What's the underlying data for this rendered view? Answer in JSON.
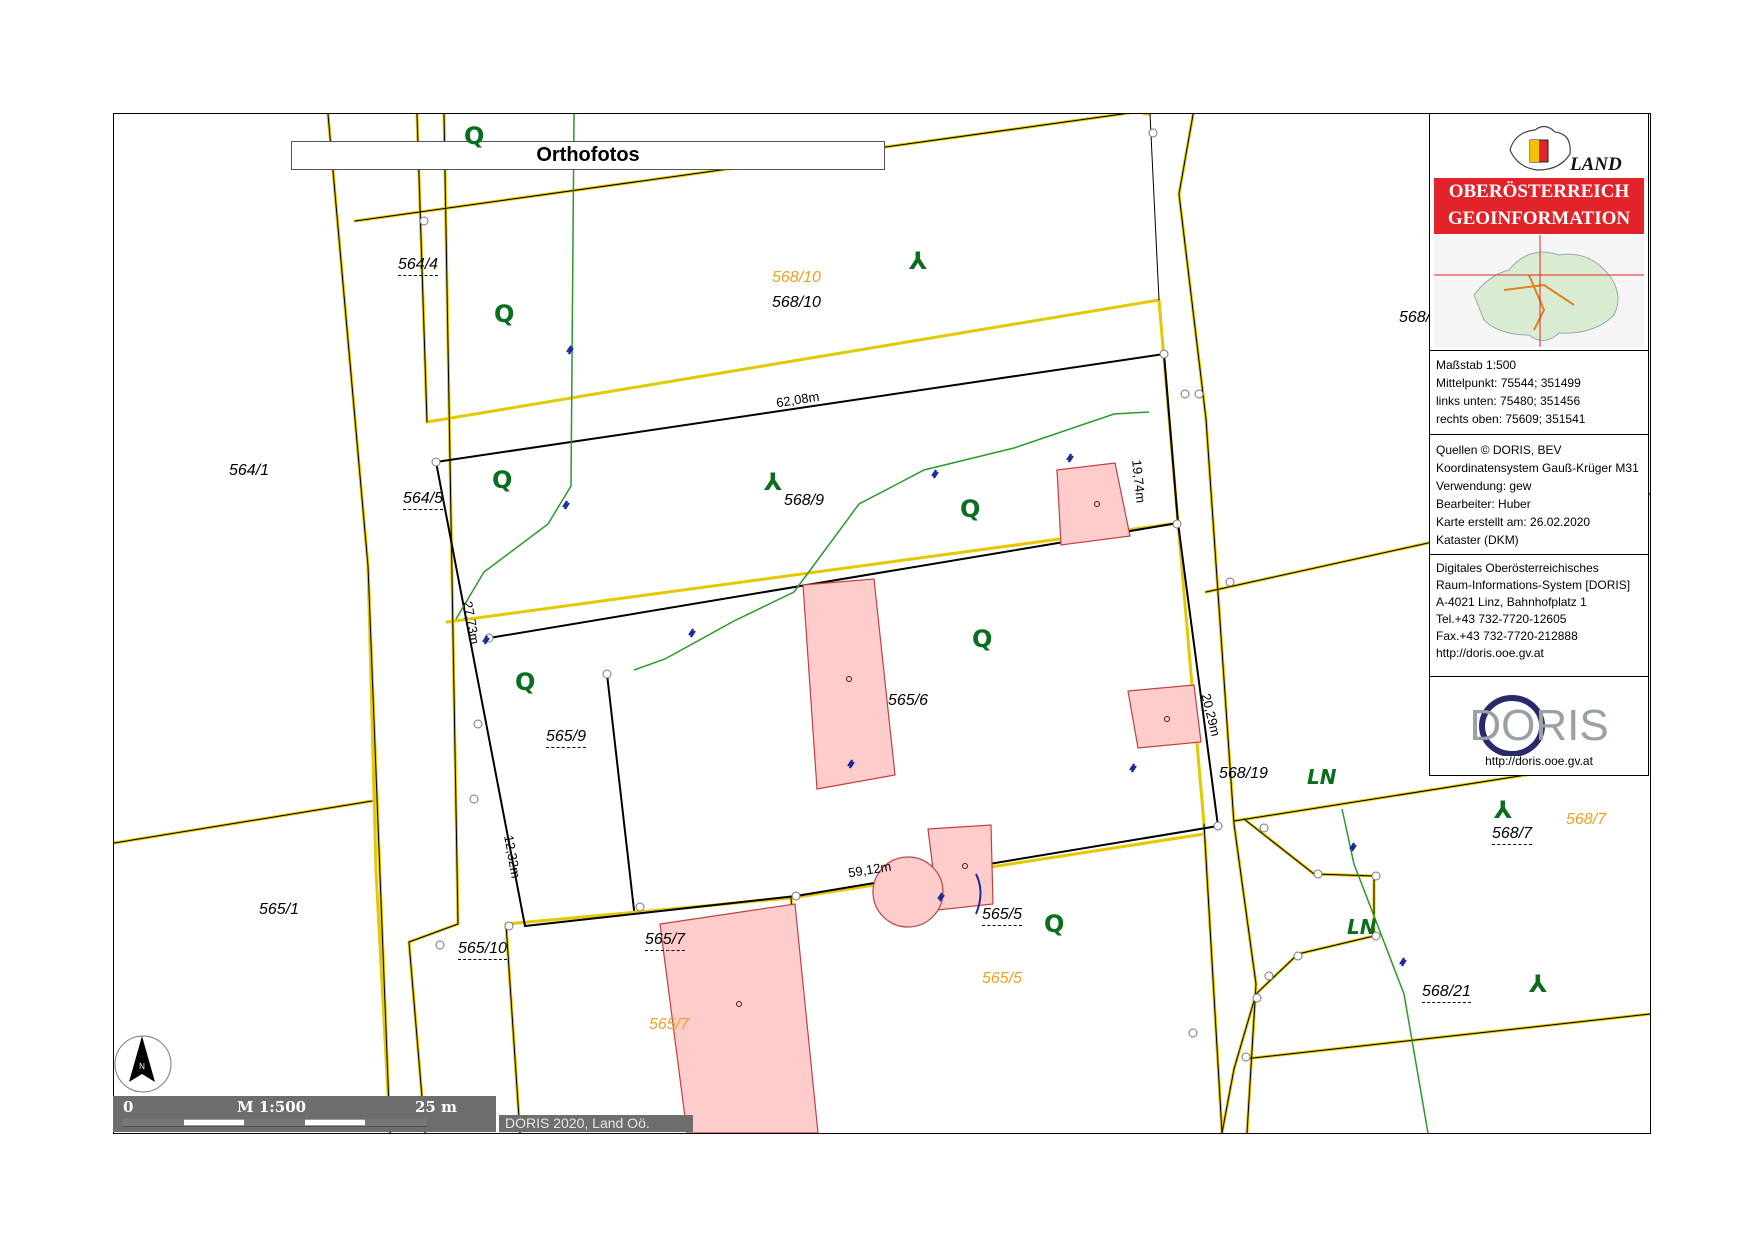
{
  "map_title": "Orthofotos",
  "parcels": [
    {
      "id": "p1",
      "text": "564/4",
      "style": "black-ul"
    },
    {
      "id": "p2",
      "text": "568/10",
      "style": "orange"
    },
    {
      "id": "p3",
      "text": "568/10",
      "style": "black"
    },
    {
      "id": "p4",
      "text": "564/1",
      "style": "black"
    },
    {
      "id": "p5",
      "text": "564/5",
      "style": "black-ul"
    },
    {
      "id": "p6",
      "text": "568/9",
      "style": "black"
    },
    {
      "id": "p7",
      "text": "565/6",
      "style": "black"
    },
    {
      "id": "p8",
      "text": "565/9",
      "style": "black-ul"
    },
    {
      "id": "p9",
      "text": "568/19",
      "style": "black"
    },
    {
      "id": "p10",
      "text": "565/1",
      "style": "black"
    },
    {
      "id": "p11",
      "text": "565/10",
      "style": "black-ul"
    },
    {
      "id": "p12",
      "text": "565/7",
      "style": "black-ul"
    },
    {
      "id": "p13",
      "text": "565/7",
      "style": "orange"
    },
    {
      "id": "p14",
      "text": "565/5",
      "style": "black-ul"
    },
    {
      "id": "p15",
      "text": "565/5",
      "style": "orange"
    },
    {
      "id": "p16",
      "text": "568/7",
      "style": "black-ul"
    },
    {
      "id": "p17",
      "text": "568/7",
      "style": "orange"
    },
    {
      "id": "p18",
      "text": "568/21",
      "style": "black-ul"
    },
    {
      "id": "p19",
      "text": "568/",
      "style": "black"
    }
  ],
  "measurements": [
    "62,08m",
    "19,74m",
    "27,73m",
    "20,29m",
    "12,32m",
    "59,12m"
  ],
  "land_use_symbols": {
    "meadow": "Q",
    "forest": "⅄",
    "ln": "LN"
  },
  "info_panel": {
    "logo": {
      "land": "LAND",
      "line1": "OBERÖSTERREICH",
      "line2": "GEOINFORMATION"
    },
    "scale_block": [
      "Maßstab 1:500",
      "Mittelpunkt: 75544; 351499",
      "links unten: 75480; 351456",
      "rechts oben: 75609; 351541"
    ],
    "source_block": [
      "Quellen © DORIS, BEV",
      "Koordinatensystem Gauß-Krüger M31",
      "Verwendung: gew",
      "Bearbeiter: Huber",
      "Karte erstellt am: 26.02.2020",
      "Kataster (DKM)"
    ],
    "address_block": [
      "Digitales Oberösterreichisches",
      "Raum-Informations-System [DORIS]",
      "A-4021 Linz, Bahnhofplatz 1",
      "Tel.+43 732-7720-12605",
      "Fax.+43 732-7720-212888",
      "http://doris.ooe.gv.at"
    ],
    "doris_logo_text": "DORIS",
    "doris_url": "http://doris.ooe.gv.at"
  },
  "scalebar": {
    "left": "0",
    "mid": "M 1:500",
    "right": "25 m"
  },
  "copyright": "DORIS 2020, Land Oö.",
  "north_label": "N",
  "colors": {
    "parcel_line": "#000000",
    "parcel_edge": "#e5c800",
    "green_line": "#2a9a2a",
    "building_fill": "#ffcccc",
    "building_stroke": "#c04040",
    "accent_red": "#e2232a",
    "orange_label": "#f0a020"
  }
}
